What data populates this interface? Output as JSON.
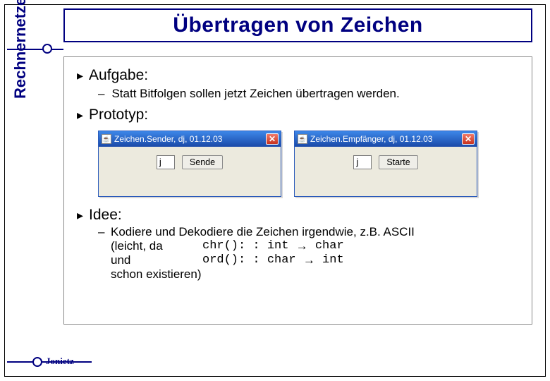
{
  "title": "Übertragen von Zeichen",
  "side_label": "Rechnernetze",
  "footer": "Jonietz",
  "bullets": {
    "aufgabe": {
      "label": "Aufgabe:",
      "detail": "Statt Bitfolgen sollen jetzt Zeichen übertragen werden."
    },
    "prototyp": {
      "label": "Prototyp:"
    },
    "idee": {
      "label": "Idee:",
      "line1_pre": "Kodiere und Dekodiere die Zeichen irgendwie, z.B. ASCII",
      "leicht": "(leicht, da",
      "chr": "chr()",
      "chr_sig": ": int",
      "chr_to": "char",
      "und": "und",
      "ord": "ord()",
      "ord_sig": ": char",
      "ord_to": "int",
      "tail": "schon existieren)"
    }
  },
  "windows": {
    "sender": {
      "title": "Zeichen.Sender, dj, 01.12.03",
      "field": "j",
      "button": "Sende"
    },
    "receiver": {
      "title": "Zeichen.Empfänger, dj, 01.12.03",
      "field": "j",
      "button": "Starte"
    }
  },
  "glyphs": {
    "l1_marker": "▸",
    "l2_marker": "–",
    "arrow": "→",
    "close": "✕",
    "colon": " :"
  }
}
